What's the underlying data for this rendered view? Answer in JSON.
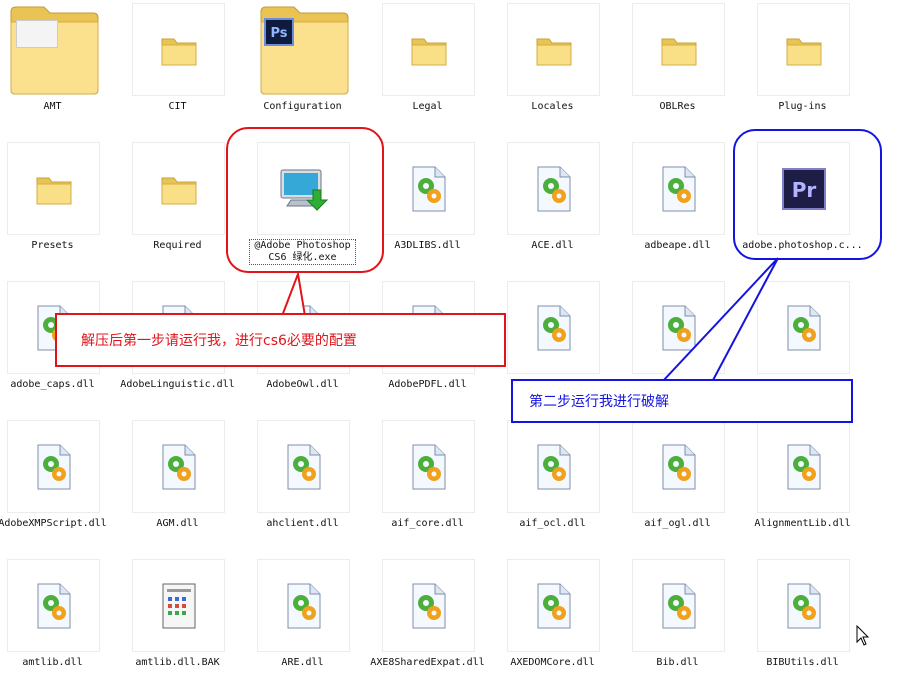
{
  "files": [
    {
      "name": "AMT",
      "kind": "folder-big"
    },
    {
      "name": "CIT",
      "kind": "folder"
    },
    {
      "name": "Configuration",
      "kind": "folder-ps"
    },
    {
      "name": "Legal",
      "kind": "folder"
    },
    {
      "name": "Locales",
      "kind": "folder"
    },
    {
      "name": "OBLRes",
      "kind": "folder"
    },
    {
      "name": "Plug-ins",
      "kind": "folder"
    },
    {
      "name": "Presets",
      "kind": "folder"
    },
    {
      "name": "Required",
      "kind": "folder"
    },
    {
      "name": "@Adobe Photoshop CS6 绿化.exe",
      "kind": "exe",
      "selected": true
    },
    {
      "name": "A3DLIBS.dll",
      "kind": "dll"
    },
    {
      "name": "ACE.dll",
      "kind": "dll"
    },
    {
      "name": "adbeape.dll",
      "kind": "dll"
    },
    {
      "name": "adobe.photoshop.c...",
      "kind": "pr"
    },
    {
      "name": "adobe_caps.dll",
      "kind": "dll"
    },
    {
      "name": "AdobeLinguistic.dll",
      "kind": "dll"
    },
    {
      "name": "AdobeOwl.dll",
      "kind": "dll"
    },
    {
      "name": "AdobePDFL.dll",
      "kind": "dll"
    },
    {
      "name": "",
      "kind": "dll"
    },
    {
      "name": "",
      "kind": "dll"
    },
    {
      "name": "",
      "kind": "dll"
    },
    {
      "name": "AdobeXMPScript.dll",
      "kind": "dll"
    },
    {
      "name": "AGM.dll",
      "kind": "dll"
    },
    {
      "name": "ahclient.dll",
      "kind": "dll"
    },
    {
      "name": "aif_core.dll",
      "kind": "dll"
    },
    {
      "name": "aif_ocl.dll",
      "kind": "dll"
    },
    {
      "name": "aif_ogl.dll",
      "kind": "dll"
    },
    {
      "name": "AlignmentLib.dll",
      "kind": "dll"
    },
    {
      "name": "amtlib.dll",
      "kind": "dll"
    },
    {
      "name": "amtlib.dll.BAK",
      "kind": "bak"
    },
    {
      "name": "ARE.dll",
      "kind": "dll"
    },
    {
      "name": "AXE8SharedExpat.dll",
      "kind": "dll"
    },
    {
      "name": "AXEDOMCore.dll",
      "kind": "dll"
    },
    {
      "name": "Bib.dll",
      "kind": "dll"
    },
    {
      "name": "BIBUtils.dll",
      "kind": "dll"
    }
  ],
  "callouts": {
    "step1": "解压后第一步请运行我，进行cs6必要的配置",
    "step2": "第二步运行我进行破解"
  },
  "colors": {
    "step1": "#e0141a",
    "step2": "#1414e0"
  }
}
